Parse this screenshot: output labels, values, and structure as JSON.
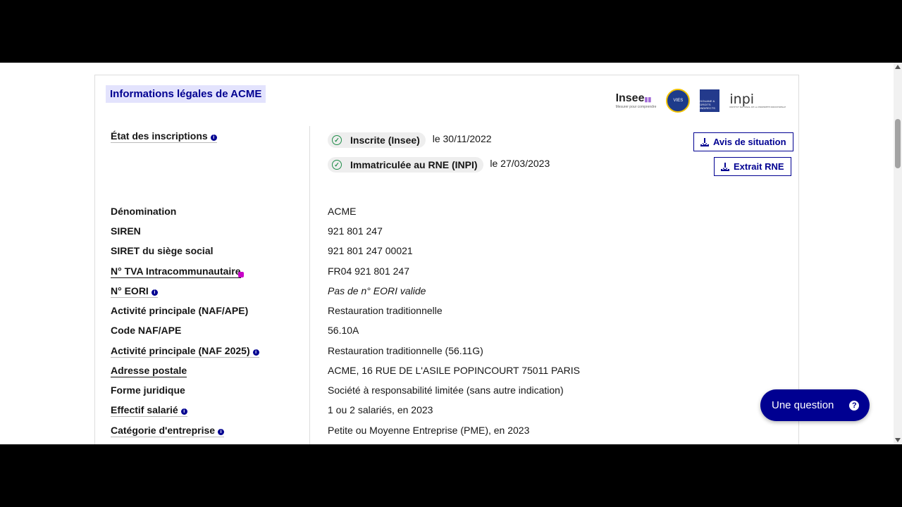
{
  "card": {
    "title": "Informations légales de ACME",
    "logos": {
      "insee": "Insee",
      "insee_tag": "Mesurer pour comprendre",
      "vies": "VIES",
      "douane": "DOUANE & DROITS INDIRECTS",
      "inpi": "inpi",
      "inpi_sub": "INSTITUT NATIONAL DE LA PROPRIÉTÉ INDUSTRIELLE"
    }
  },
  "inscriptions": {
    "label": "État des inscriptions",
    "rows": [
      {
        "badge": "Inscrite (Insee)",
        "date": "le 30/11/2022",
        "button": "Avis de situation"
      },
      {
        "badge": "Immatriculée au RNE (INPI)",
        "date": "le 27/03/2023",
        "button": "Extrait RNE"
      }
    ]
  },
  "fields": [
    {
      "label": "Dénomination",
      "value": "ACME"
    },
    {
      "label": "SIREN",
      "value": "921 801 247"
    },
    {
      "label": "SIRET du siège social",
      "value": "921 801 247 00021"
    },
    {
      "label": "N° TVA Intracommunautaire",
      "value": "FR04 921 801 247"
    },
    {
      "label": "N° EORI",
      "value": "Pas de n° EORI valide"
    },
    {
      "label": "Activité principale (NAF/APE)",
      "value": "Restauration traditionnelle"
    },
    {
      "label": "Code NAF/APE",
      "value": "56.10A"
    },
    {
      "label": "Activité principale (NAF 2025)",
      "value": "Restauration traditionnelle (56.11G)"
    },
    {
      "label": "Adresse postale",
      "value": "ACME, 16 RUE DE L'ASILE POPINCOURT 75011 PARIS"
    },
    {
      "label": "Forme juridique",
      "value": "Société à responsabilité limitée (sans autre indication)"
    },
    {
      "label": "Effectif salarié",
      "value": "1 ou 2 salariés, en 2023"
    },
    {
      "label": "Catégorie d'entreprise",
      "value": "Petite ou Moyenne Entreprise (PME), en 2023"
    }
  ],
  "info_glyph": "i",
  "fab": {
    "label": "Une question",
    "icon": "?"
  },
  "colors": {
    "primary": "#000091",
    "success": "#1f8d49",
    "title_bg": "#e3e3fd"
  }
}
